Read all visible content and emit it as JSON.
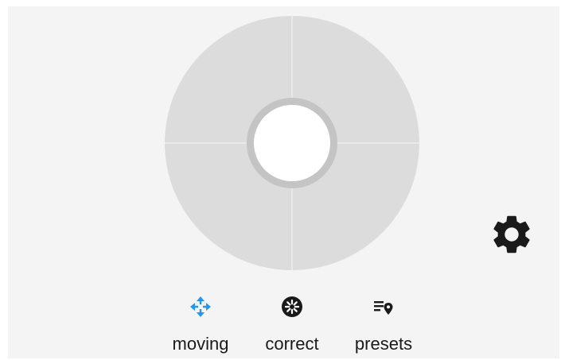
{
  "app": {
    "accent_color": "#2196f3",
    "icon_color": "#1a1a1a"
  },
  "joystick": {
    "name": "pan-tilt-joystick"
  },
  "settings": {
    "icon": "gear-icon"
  },
  "modes": [
    {
      "id": "moving",
      "label": "moving",
      "icon": "move-arrows-icon",
      "active": true
    },
    {
      "id": "correct",
      "label": "correct",
      "icon": "aperture-icon",
      "active": false
    },
    {
      "id": "presets",
      "label": "presets",
      "icon": "preset-list-location-icon",
      "active": false
    }
  ]
}
